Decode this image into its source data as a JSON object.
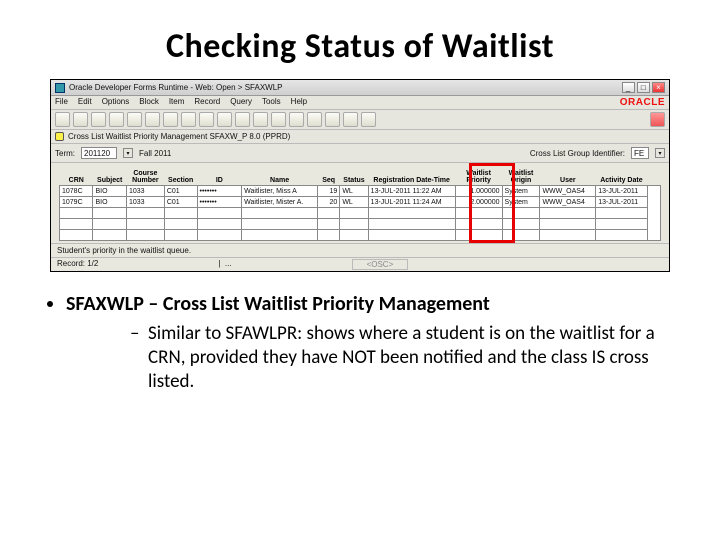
{
  "slide": {
    "title": "Checking Status of Waitlist",
    "bullet_main_code": "SFAXWLP",
    "bullet_main_rest": " – Cross List Waitlist Priority Management",
    "sub_bullet": "Similar to SFAWLPR: shows where a student is on the waitlist for a CRN, provided they have NOT been notified and the class IS cross listed."
  },
  "window": {
    "titlebar": "Oracle Developer Forms Runtime - Web: Open > SFAXWLP",
    "menus": [
      "File",
      "Edit",
      "Options",
      "Block",
      "Item",
      "Record",
      "Query",
      "Tools",
      "Help"
    ],
    "brand": "ORACLE",
    "form_header": "Cross List Waitlist Priority Management SFAXW_P 8.0 (PPRD)",
    "filter": {
      "term_label": "Term:",
      "term_value": "201120",
      "term_desc": "Fall 2011",
      "group_label": "Cross List Group Identifier:",
      "group_value": "FE"
    },
    "columns": [
      "CRN",
      "Subject",
      "Course Number",
      "Section",
      "ID",
      "Name",
      "Seq",
      "Status",
      "Registration Date-Time",
      "Waitlist Priority",
      "Waitlist Origin",
      "User",
      "Activity Date"
    ],
    "rows": [
      {
        "crn": "1078C",
        "subj": "BIO",
        "num": "1033",
        "sec": "C01",
        "id": "•••••••",
        "name": "Waitlister, Miss A",
        "seq": "19",
        "status": "WL",
        "regdt": "13-JUL-2011 11:22 AM",
        "priority": "1.000000",
        "origin": "System",
        "user": "WWW_OAS4",
        "actdt": "13-JUL-2011"
      },
      {
        "crn": "1079C",
        "subj": "BIO",
        "num": "1033",
        "sec": "C01",
        "id": "•••••••",
        "name": "Waitlister, Mister A.",
        "seq": "20",
        "status": "WL",
        "regdt": "13-JUL-2011 11:24 AM",
        "priority": "2.000000",
        "origin": "System",
        "user": "WWW_OAS4",
        "actdt": "13-JUL-2011"
      }
    ],
    "status_text": "Student's priority in the waitlist queue.",
    "record_text": "Record: 1/2",
    "osc": "<OSC>"
  }
}
